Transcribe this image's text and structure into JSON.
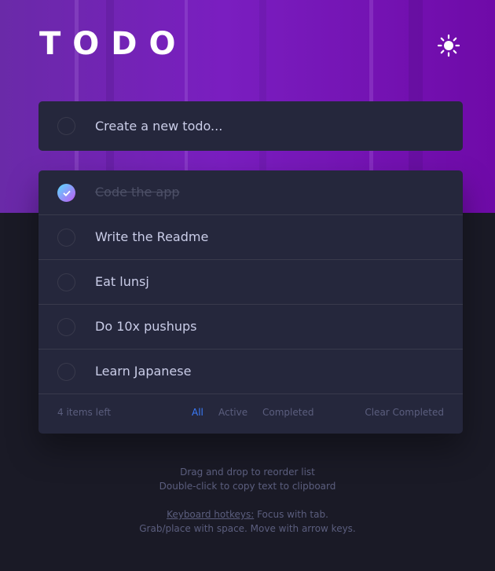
{
  "app": {
    "title": "TODO"
  },
  "colors": {
    "accent": "#3a7cfd",
    "card": "#25273c",
    "check_gradient": [
      "#57ddff",
      "#c058f3"
    ]
  },
  "new_todo": {
    "placeholder": "Create a new todo..."
  },
  "todos": [
    {
      "text": "Code the app",
      "completed": true
    },
    {
      "text": "Write the Readme",
      "completed": false
    },
    {
      "text": "Eat lunsj",
      "completed": false
    },
    {
      "text": "Do 10x pushups",
      "completed": false
    },
    {
      "text": "Learn Japanese",
      "completed": false
    }
  ],
  "footer": {
    "items_left": "4 items left",
    "filters": [
      "All",
      "Active",
      "Completed"
    ],
    "active_filter": "All",
    "clear_label": "Clear Completed"
  },
  "hints": {
    "line1": "Drag and drop to reorder list",
    "line2": "Double-click to copy text to clipboard",
    "hotkeys_link": "Keyboard hotkeys:",
    "hotkeys_rest": " Focus with tab.",
    "line4": "Grab/place with space. Move with arrow keys."
  },
  "icons": {
    "theme_toggle": "sun-icon",
    "check": "check-icon"
  }
}
